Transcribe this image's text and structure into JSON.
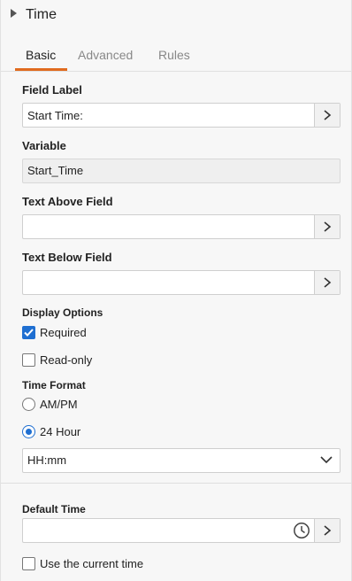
{
  "header": {
    "title": "Time"
  },
  "tabs": [
    {
      "label": "Basic",
      "active": true
    },
    {
      "label": "Advanced",
      "active": false
    },
    {
      "label": "Rules",
      "active": false
    }
  ],
  "fields": {
    "field_label": {
      "label": "Field Label",
      "value": "Start Time:"
    },
    "variable": {
      "label": "Variable",
      "value": "Start_Time"
    },
    "text_above": {
      "label": "Text Above Field",
      "value": ""
    },
    "text_below": {
      "label": "Text Below Field",
      "value": ""
    }
  },
  "display_options": {
    "label": "Display Options",
    "required": {
      "label": "Required",
      "checked": true
    },
    "read_only": {
      "label": "Read-only",
      "checked": false
    }
  },
  "time_format": {
    "label": "Time Format",
    "ampm": {
      "label": "AM/PM",
      "selected": false
    },
    "h24": {
      "label": "24 Hour",
      "selected": true
    },
    "pattern": "HH:mm"
  },
  "default_time": {
    "label": "Default Time",
    "value": "",
    "use_current": {
      "label": "Use the current time",
      "checked": false
    }
  },
  "icons": {
    "expand": "caret-right-icon",
    "chevron": "chevron-right-icon",
    "select": "chevron-down-icon",
    "clock": "clock-icon"
  },
  "colors": {
    "accent_tab": "#e06b1f",
    "checkbox_blue": "#1f6fd1"
  }
}
